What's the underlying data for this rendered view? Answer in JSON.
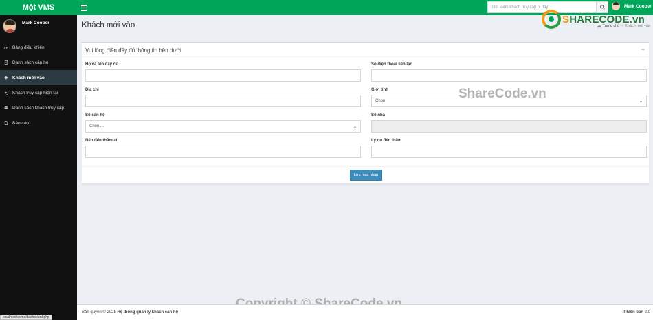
{
  "brand": "Một VMS",
  "header": {
    "search_placeholder": "Tìm kiếm khách truy cập ở đây",
    "user_name": "Mark Cooper"
  },
  "sidebar": {
    "user_name": "Mark Cooper",
    "items": [
      {
        "label": "Bảng điều khiển",
        "icon": "dashboard-icon"
      },
      {
        "label": "Danh sách căn hộ",
        "icon": "building-icon"
      },
      {
        "label": "Khách mới vào",
        "icon": "plus-icon"
      },
      {
        "label": "Khách truy cập hiện tại",
        "icon": "sign-in-icon"
      },
      {
        "label": "Danh sách khách truy cập",
        "icon": "users-icon"
      },
      {
        "label": "Báo cáo",
        "icon": "file-icon"
      }
    ]
  },
  "page": {
    "title": "Khách mới vào",
    "breadcrumb_home": "Trang chủ",
    "breadcrumb_current": "Khách mới vào"
  },
  "form": {
    "title": "Vui lòng điền đầy đủ thông tin bên dưới",
    "collapse": "−",
    "fullname_label": "Họ và tên đầy đủ",
    "fullname_value": "",
    "phone_label": "Số điện thoại liên lạc",
    "phone_value": "",
    "address_label": "Địa chỉ",
    "address_value": "",
    "gender_label": "Giới tính",
    "gender_value": "Chọn",
    "apartment_label": "Số căn hộ",
    "apartment_value": "Chọn....",
    "house_label": "Số nhà",
    "house_value": "",
    "host_label": "Nên đến thăm ai",
    "host_value": "",
    "reason_label": "Lý do đến thăm",
    "reason_value": "",
    "submit_label": "Lưu mục nhập"
  },
  "logo": {
    "part1": "S",
    "part2": "HARECODE",
    "part3": ".vn"
  },
  "watermark": {
    "mid": "ShareCode.vn",
    "bottom": "Copyright © ShareCode.vn"
  },
  "footer": {
    "copyright_prefix": "Bản quyền © 2025",
    "copyright_name": "Hệ thống quản lý khách căn hộ",
    "version_label": "Phiên bản",
    "version_value": "2.0"
  },
  "statusbar": "localhost/avms/dashboard.php",
  "colors": {
    "primary_green": "#00a65a",
    "sidebar_bg": "#111111",
    "button_blue": "#3c8dbc"
  }
}
